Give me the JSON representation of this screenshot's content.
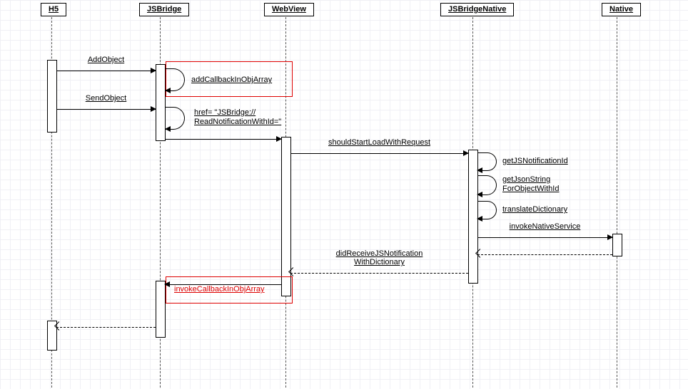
{
  "actors": {
    "h5": "H5",
    "jsbridge": "JSBridge",
    "webview": "WebView",
    "jsbridgenative": "JSBridgeNative",
    "native": "Native"
  },
  "messages": {
    "addObject": "AddObject",
    "sendObject": "SendObject",
    "addCallbackInObjArray": "addCallbackInObjArray",
    "href": "href= \"JSBridge://\nReadNotificationWithId=\"",
    "shouldStartLoadWithRequest": "shouldStartLoadWithRequest",
    "getJSNotificationId": "getJSNotificationId",
    "getJsonStringForObjectWithId": "getJsonString\nForObjectWithId",
    "translateDictionary": "translateDictionary",
    "invokeNativeService": "invokeNativeService",
    "didReceiveJSNotification": "didReceiveJSNotification\nWithDictionary",
    "invokeCallbackInObjArray": "invokeCallbackInObjArray"
  },
  "chart_data": {
    "type": "sequence-diagram",
    "participants": [
      "H5",
      "JSBridge",
      "WebView",
      "JSBridgeNative",
      "Native"
    ],
    "interactions": [
      {
        "from": "H5",
        "to": "JSBridge",
        "label": "AddObject",
        "kind": "sync"
      },
      {
        "from": "JSBridge",
        "to": "JSBridge",
        "label": "addCallbackInObjArray",
        "kind": "self",
        "highlight": true
      },
      {
        "from": "H5",
        "to": "JSBridge",
        "label": "SendObject",
        "kind": "sync"
      },
      {
        "from": "JSBridge",
        "to": "JSBridge",
        "label": "href= \"JSBridge://ReadNotificationWithId=\"",
        "kind": "self"
      },
      {
        "from": "JSBridge",
        "to": "WebView",
        "label": "",
        "kind": "sync"
      },
      {
        "from": "WebView",
        "to": "JSBridgeNative",
        "label": "shouldStartLoadWithRequest",
        "kind": "sync"
      },
      {
        "from": "JSBridgeNative",
        "to": "JSBridgeNative",
        "label": "getJSNotificationId",
        "kind": "self"
      },
      {
        "from": "JSBridgeNative",
        "to": "JSBridgeNative",
        "label": "getJsonStringForObjectWithId",
        "kind": "self"
      },
      {
        "from": "JSBridgeNative",
        "to": "JSBridgeNative",
        "label": "translateDictionary",
        "kind": "self"
      },
      {
        "from": "JSBridgeNative",
        "to": "Native",
        "label": "invokeNativeService",
        "kind": "sync"
      },
      {
        "from": "Native",
        "to": "JSBridgeNative",
        "label": "",
        "kind": "return"
      },
      {
        "from": "JSBridgeNative",
        "to": "WebView",
        "label": "didReceiveJSNotificationWithDictionary",
        "kind": "return"
      },
      {
        "from": "WebView",
        "to": "JSBridge",
        "label": "",
        "kind": "sync"
      },
      {
        "from": "JSBridge",
        "to": "JSBridge",
        "label": "invokeCallbackInObjArray",
        "kind": "self",
        "highlight": true
      },
      {
        "from": "JSBridge",
        "to": "H5",
        "label": "",
        "kind": "return"
      }
    ]
  }
}
